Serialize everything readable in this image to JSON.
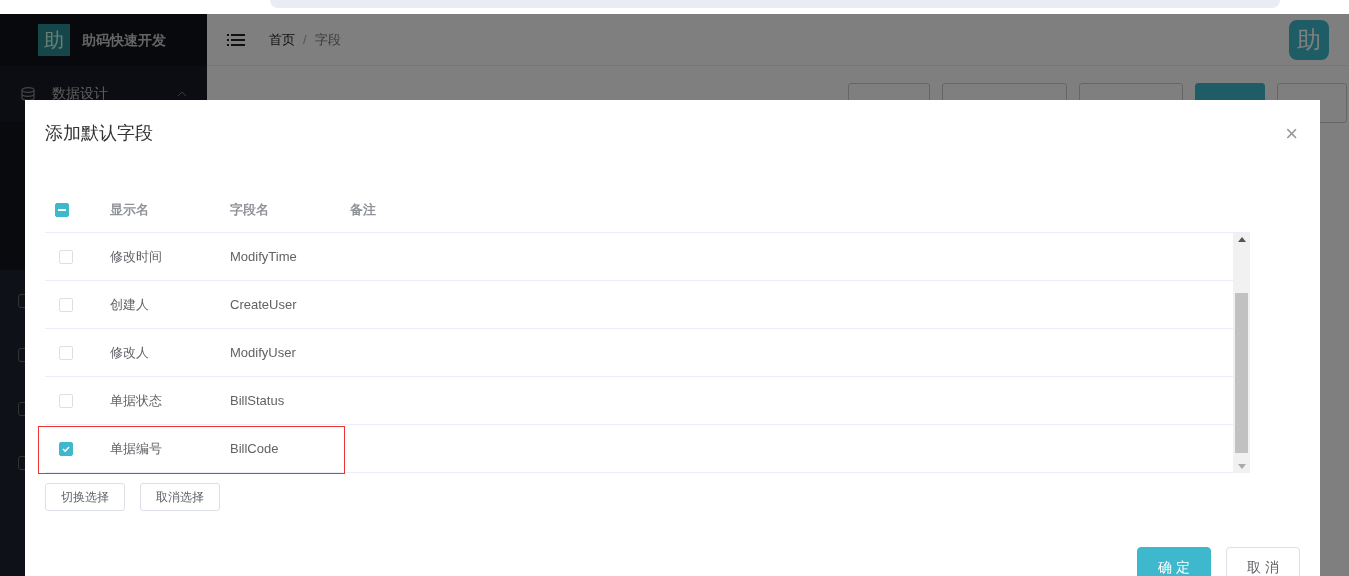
{
  "app": {
    "logo": "助",
    "name": "助码快速开发",
    "avatar": "助"
  },
  "sidebar": {
    "items": [
      {
        "label": "数据设计",
        "expanded": true
      }
    ]
  },
  "breadcrumb": [
    {
      "label": "首页",
      "selected": false
    },
    {
      "label": "字段",
      "selected": true,
      "separator": "/"
    }
  ],
  "dialog": {
    "title": "添加默认字段",
    "close": "×",
    "table": {
      "columns": [
        "显示名",
        "字段名",
        "备注"
      ],
      "header_check": {
        "indeterminate": true
      },
      "rows": [
        {
          "display": "修改时间",
          "field": "ModifyTime",
          "checked": false,
          "highlighted": false
        },
        {
          "display": "创建人",
          "field": "CreateUser",
          "checked": false,
          "highlighted": false
        },
        {
          "display": "修改人",
          "field": "ModifyUser",
          "checked": false,
          "highlighted": false
        },
        {
          "display": "单据状态",
          "field": "BillStatus",
          "checked": false,
          "highlighted": false
        },
        {
          "display": "单据编号",
          "field": "BillCode",
          "checked": true,
          "highlighted": true
        }
      ]
    },
    "actions": [
      "切换选择",
      "取消选择"
    ],
    "footer": [
      {
        "label": "确 定",
        "kind": "primary"
      },
      {
        "label": "取 消",
        "kind": "default"
      }
    ]
  }
}
